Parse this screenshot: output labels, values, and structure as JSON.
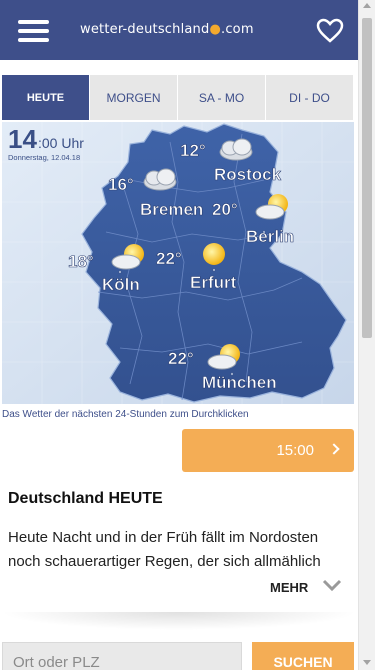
{
  "header": {
    "logo_text_left": "wetter-deutschland",
    "logo_text_right": ".com"
  },
  "tabs": [
    {
      "label": "HEUTE",
      "active": true
    },
    {
      "label": "MORGEN",
      "active": false
    },
    {
      "label": "SA - MO",
      "active": false
    },
    {
      "label": "DI - DO",
      "active": false
    }
  ],
  "map": {
    "time_big": "14",
    "time_small": ":00 Uhr",
    "date": "Donnerstag, 12.04.18",
    "cities": [
      {
        "name": "Rostock",
        "temp": "12°",
        "icon": "cloud-icon"
      },
      {
        "name": "Bremen",
        "temp": "16°",
        "icon": "cloud-icon"
      },
      {
        "name": "Berlin",
        "temp": "20°",
        "icon": "sun-cloud-icon"
      },
      {
        "name": "Köln",
        "temp": "18°",
        "icon": "sun-cloud-icon"
      },
      {
        "name": "Erfurt",
        "temp": "22°",
        "icon": "sun-icon"
      },
      {
        "name": "München",
        "temp": "22°",
        "icon": "sun-cloud-icon"
      }
    ]
  },
  "caption": "Das Wetter der nächsten 24-Stunden zum Durchklicken",
  "time_button": "15:00",
  "section": {
    "title": "Deutschland HEUTE",
    "text": "Heute Nacht und in der Früh fällt im Nordosten noch schauerartiger Regen, der sich allmählich"
  },
  "more_label": "MEHR",
  "search": {
    "placeholder": "Ort oder PLZ",
    "button_label": "SUCHEN"
  },
  "colors": {
    "brand": "#3e4f8a",
    "accent": "#f4ad55"
  }
}
